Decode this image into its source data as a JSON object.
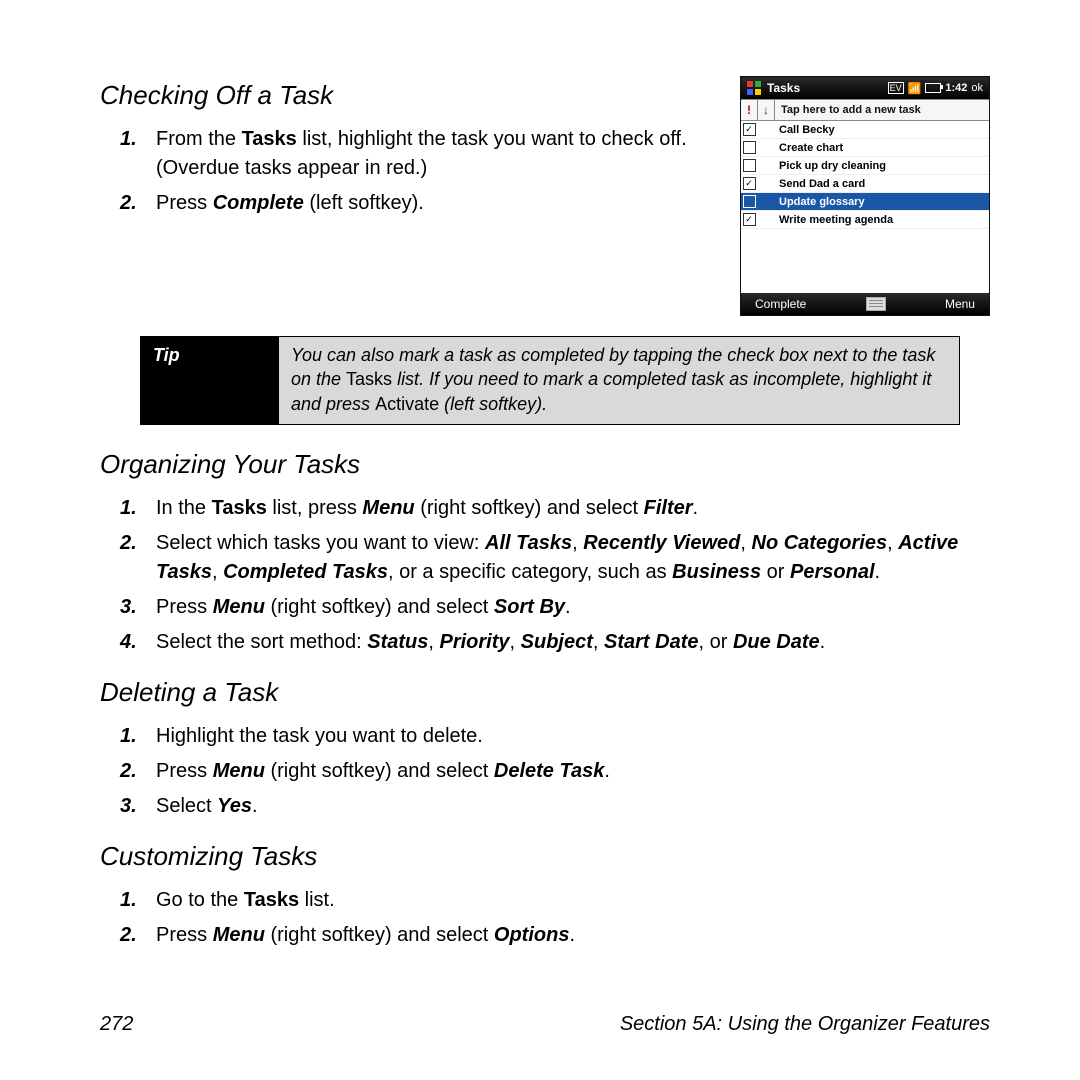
{
  "sections": {
    "checking": {
      "heading": "Checking Off a Task",
      "steps": [
        {
          "num": "1.",
          "pre": "From the ",
          "b1": "Tasks",
          "post": " list, highlight the task you want to check off. (Overdue tasks appear in red.)"
        },
        {
          "num": "2.",
          "pre": "Press ",
          "b1": "Complete",
          "post": " (left softkey)."
        }
      ]
    },
    "tip": {
      "label": "Tip",
      "t1": "You can also mark a task as completed by tapping the check box next to the task on the ",
      "b1": "Tasks",
      "t2": " list. If you need to mark a completed task as incomplete, highlight it and press ",
      "b2": "Activate",
      "t3": " (left softkey)."
    },
    "organizing": {
      "heading": "Organizing Your Tasks",
      "step1": {
        "num": "1.",
        "a": "In the ",
        "b1": "Tasks",
        "b": " list, press ",
        "b2": "Menu",
        "c": " (right softkey) and select ",
        "b3": "Filter",
        "d": "."
      },
      "step2": {
        "num": "2.",
        "a": "Select which tasks you want to view: ",
        "o1": "All Tasks",
        "s1": ", ",
        "o2": "Recently Viewed",
        "s2": ", ",
        "o3": "No Categories",
        "s3": ", ",
        "o4": "Active Tasks",
        "s4": ", ",
        "o5": "Completed Tasks",
        "b": ", or a specific category, such as ",
        "o6": "Business",
        "c": " or ",
        "o7": "Personal",
        "d": "."
      },
      "step3": {
        "num": "3.",
        "a": "Press ",
        "b1": "Menu",
        "b": " (right softkey) and select ",
        "b2": "Sort By",
        "c": "."
      },
      "step4": {
        "num": "4.",
        "a": "Select the sort method: ",
        "o1": "Status",
        "s1": ", ",
        "o2": "Priority",
        "s2": ", ",
        "o3": "Subject",
        "s3": ", ",
        "o4": "Start Date",
        "b": ", or ",
        "o5": "Due Date",
        "c": "."
      }
    },
    "deleting": {
      "heading": "Deleting a Task",
      "step1": {
        "num": "1.",
        "a": "Highlight the task you want to delete."
      },
      "step2": {
        "num": "2.",
        "a": "Press ",
        "b1": "Menu",
        "b": " (right softkey) and select ",
        "b2": "Delete Task",
        "c": "."
      },
      "step3": {
        "num": "3.",
        "a": "Select ",
        "b1": "Yes",
        "b": "."
      }
    },
    "customizing": {
      "heading": "Customizing Tasks",
      "step1": {
        "num": "1.",
        "a": "Go to the ",
        "b1": "Tasks",
        "b": " list."
      },
      "step2": {
        "num": "2.",
        "a": "Press ",
        "b1": "Menu",
        "b": " (right softkey) and select ",
        "b2": "Options",
        "c": "."
      }
    }
  },
  "footer": {
    "page": "272",
    "label": "Section 5A: Using the Organizer Features"
  },
  "screenshot": {
    "title": "Tasks",
    "ev": "EV",
    "time": "1:42",
    "ok": "ok",
    "col1": "!",
    "col2": "↓",
    "hint": "Tap here to add a new task",
    "rows": [
      {
        "checked": true,
        "label": "Call Becky",
        "selected": false
      },
      {
        "checked": false,
        "label": "Create chart",
        "selected": false
      },
      {
        "checked": false,
        "label": "Pick up dry cleaning",
        "selected": false
      },
      {
        "checked": true,
        "label": "Send Dad a card",
        "selected": false
      },
      {
        "checked": false,
        "label": "Update glossary",
        "selected": true
      },
      {
        "checked": true,
        "label": "Write meeting agenda",
        "selected": false
      }
    ],
    "left_soft": "Complete",
    "right_soft": "Menu"
  }
}
